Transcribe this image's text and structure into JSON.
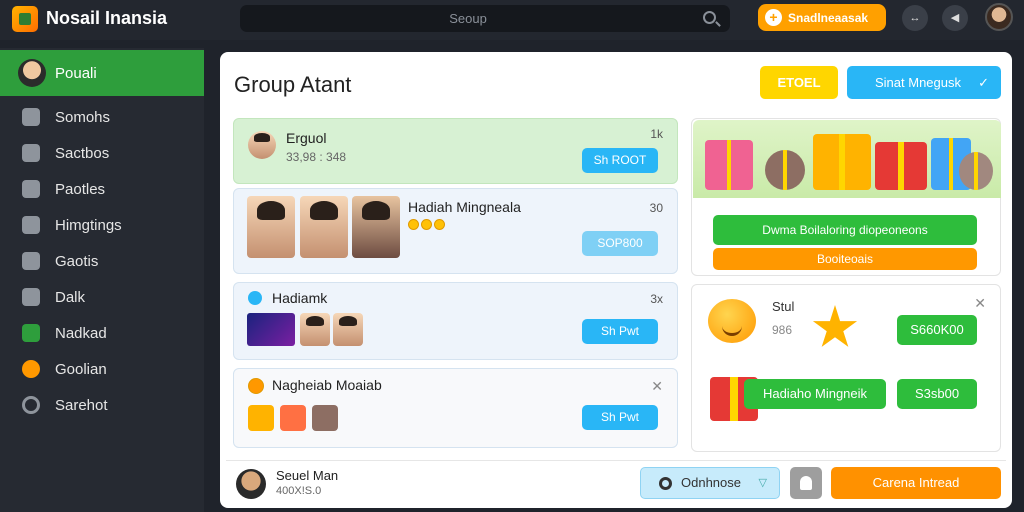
{
  "app": {
    "title": "Nosail Inansia"
  },
  "search": {
    "placeholder": "Seoup"
  },
  "top": {
    "action_label": "Snadlneaasak",
    "icon1_glyph": "↔",
    "icon2_glyph": "◀"
  },
  "sidebar": {
    "items": [
      {
        "label": "Pouali",
        "icon": "avatar",
        "active": true
      },
      {
        "label": "Somohs",
        "icon": "phone-icon"
      },
      {
        "label": "Sactbos",
        "icon": "doc-icon"
      },
      {
        "label": "Paotles",
        "icon": "controller-icon"
      },
      {
        "label": "Himgtings",
        "icon": "chat-icon"
      },
      {
        "label": "Gaotis",
        "icon": "lock-icon"
      },
      {
        "label": "Dalk",
        "icon": "tag-icon"
      },
      {
        "label": "Nadkad",
        "icon": "card-icon"
      },
      {
        "label": "Goolian",
        "icon": "emoji-icon"
      },
      {
        "label": "Sarehot",
        "icon": "circle-icon"
      }
    ]
  },
  "main": {
    "title": "Group Atant",
    "btn_yellow": "ETOEL",
    "btn_blue": "Sinat Mnegusk",
    "btn_blue_check": "✓"
  },
  "cards": [
    {
      "title": "Erguol",
      "sub": "33,98 : 348",
      "num": "1k",
      "button": "Sh ROOT"
    },
    {
      "title": "Hadiah Mingneala",
      "num": "30",
      "button": "SOP800"
    },
    {
      "title": "Hadiamk",
      "num": "3x",
      "button": "Sh Pwt"
    },
    {
      "title": "Nagheiab Moaiab",
      "num": "✕",
      "button": "Sh Pwt"
    }
  ],
  "promo": {
    "green_label": "Dwma Boilaloring diopeoneons",
    "orange_label": "Booiteoais"
  },
  "rewards": {
    "close": "✕",
    "label1": "Stul",
    "label2": "986",
    "button1": "S660K00",
    "label3": "Hadiaho Mingneik",
    "button2": "S3sb00"
  },
  "footer": {
    "name": "Seuel Man",
    "id": "400X!S.0",
    "select_label": "Odnhnose",
    "select_chevron": "▽",
    "cta": "Carena Intread"
  }
}
